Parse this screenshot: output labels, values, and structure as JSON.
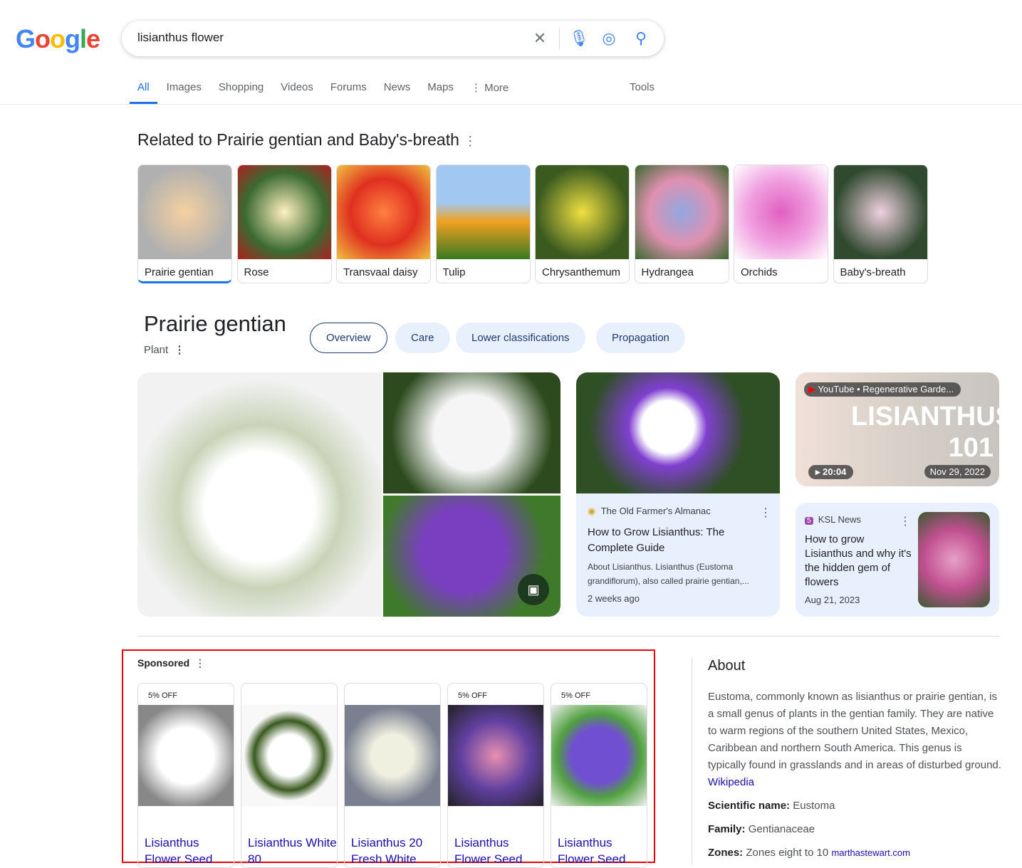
{
  "logo": "Google",
  "search": {
    "query": "lisianthus flower"
  },
  "tabs": [
    "All",
    "Images",
    "Shopping",
    "Videos",
    "Forums",
    "News",
    "Maps",
    "More"
  ],
  "tools": "Tools",
  "related": {
    "title": "Related to Prairie gentian and Baby's-breath",
    "items": [
      "Prairie gentian",
      "Rose",
      "Transvaal daisy",
      "Tulip",
      "Chrysanthemum",
      "Hydrangea",
      "Orchids",
      "Baby's-breath"
    ]
  },
  "kp": {
    "title": "Prairie gentian",
    "subtitle": "Plant",
    "pills": [
      "Overview",
      "Care",
      "Lower classifications",
      "Propagation"
    ]
  },
  "article": {
    "source": "The Old Farmer's Almanac",
    "title": "How to Grow Lisianthus: The Complete Guide",
    "snippet": "About Lisianthus. Lisianthus (Eustoma grandiflorum), also called prairie gentian,...",
    "date": "2 weeks ago"
  },
  "video": {
    "source": "YouTube • Regenerative Garde...",
    "duration": "20:04",
    "date": "Nov 29, 2022",
    "overlay": "LISIANTHUS 101"
  },
  "news": {
    "source": "KSL News",
    "title": "How to grow Lisianthus and why it's the hidden gem of flowers",
    "date": "Aug 21, 2023"
  },
  "sponsored": {
    "label": "Sponsored",
    "products": [
      {
        "badge": "5% OFF",
        "title": "Lisianthus Flower Seed"
      },
      {
        "badge": "",
        "title": "Lisianthus White 80"
      },
      {
        "badge": "",
        "title": "Lisianthus 20 Fresh White"
      },
      {
        "badge": "5% OFF",
        "title": "Lisianthus Flower Seed"
      },
      {
        "badge": "5% OFF",
        "title": "Lisianthus Flower Seed"
      }
    ]
  },
  "about": {
    "title": "About",
    "text": "Eustoma, commonly known as lisianthus or prairie gentian, is a small genus of plants in the gentian family. They are native to warm regions of the southern United States, Mexico, Caribbean and northern South America. This genus is typically found in grasslands and in areas of disturbed ground.",
    "link": "Wikipedia",
    "facts": [
      {
        "k": "Scientific name:",
        "v": "Eustoma"
      },
      {
        "k": "Family:",
        "v": "Gentianaceae"
      },
      {
        "k": "Zones:",
        "v": "Zones eight to 10",
        "src": "marthastewart.com"
      }
    ]
  }
}
